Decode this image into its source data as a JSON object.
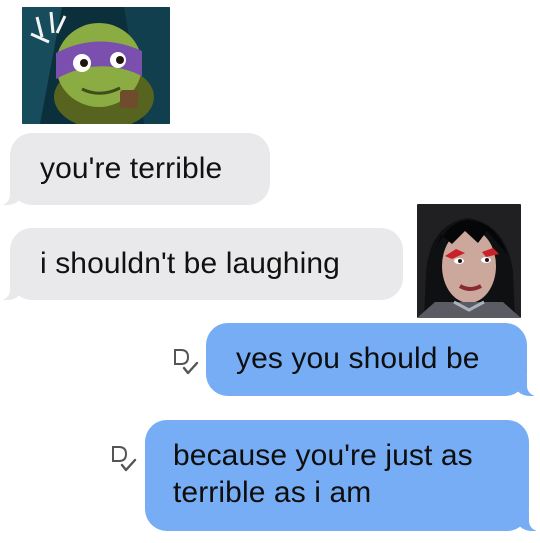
{
  "conversation": {
    "messages": [
      {
        "direction": "incoming",
        "text": "you're terrible"
      },
      {
        "direction": "incoming",
        "text": "i shouldn't be laughing"
      },
      {
        "direction": "outgoing",
        "text": "yes you should be"
      },
      {
        "direction": "outgoing",
        "text": "because you're just as terrible as i am"
      }
    ],
    "avatars": {
      "left": "turtle-character-avatar",
      "right": "dark-haired-character-avatar"
    },
    "receipt_icon": "delivered-check-icon"
  },
  "colors": {
    "incoming_bubble": "#e9e9eb",
    "outgoing_bubble": "#77adf5",
    "background": "#ffffff",
    "text": "#111111"
  }
}
